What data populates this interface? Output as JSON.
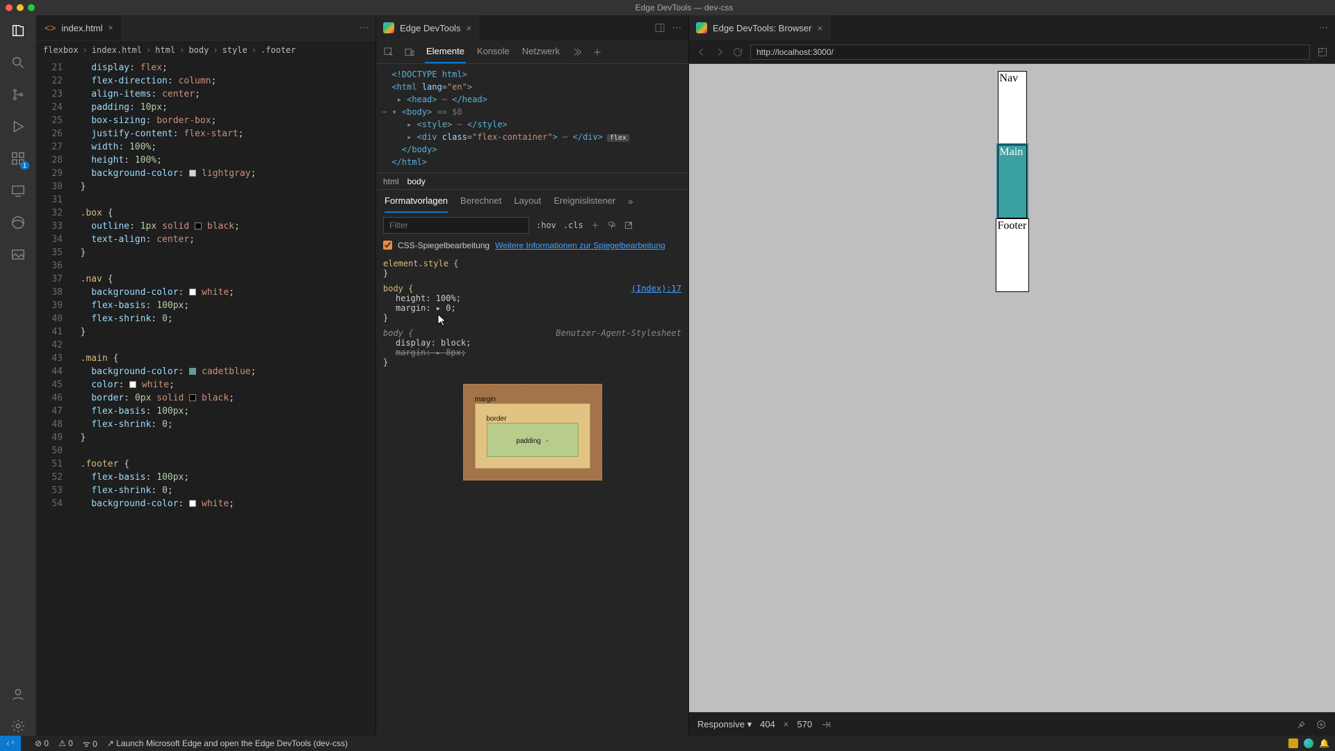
{
  "window_title": "Edge DevTools — dev-css",
  "editor_tab": {
    "filename": "index.html"
  },
  "breadcrumbs": [
    "flexbox",
    "index.html",
    "html",
    "body",
    "style",
    ".footer"
  ],
  "line_start": 21,
  "code_lines": [
    [
      [
        "prop",
        "display"
      ],
      [
        "punc",
        ": "
      ],
      [
        "val",
        "flex"
      ],
      [
        "punc",
        ";"
      ]
    ],
    [
      [
        "prop",
        "flex-direction"
      ],
      [
        "punc",
        ": "
      ],
      [
        "val",
        "column"
      ],
      [
        "punc",
        ";"
      ]
    ],
    [
      [
        "prop",
        "align-items"
      ],
      [
        "punc",
        ": "
      ],
      [
        "val",
        "center"
      ],
      [
        "punc",
        ";"
      ]
    ],
    [
      [
        "prop",
        "padding"
      ],
      [
        "punc",
        ": "
      ],
      [
        "num",
        "10px"
      ],
      [
        "punc",
        ";"
      ]
    ],
    [
      [
        "prop",
        "box-sizing"
      ],
      [
        "punc",
        ": "
      ],
      [
        "val",
        "border-box"
      ],
      [
        "punc",
        ";"
      ]
    ],
    [
      [
        "prop",
        "justify-content"
      ],
      [
        "punc",
        ": "
      ],
      [
        "val",
        "flex-start"
      ],
      [
        "punc",
        ";"
      ]
    ],
    [
      [
        "prop",
        "width"
      ],
      [
        "punc",
        ": "
      ],
      [
        "num",
        "100%"
      ],
      [
        "punc",
        ";"
      ]
    ],
    [
      [
        "prop",
        "height"
      ],
      [
        "punc",
        ": "
      ],
      [
        "num",
        "100%"
      ],
      [
        "punc",
        ";"
      ]
    ],
    [
      [
        "prop",
        "background-color"
      ],
      [
        "punc",
        ": "
      ],
      [
        "swatch",
        "#d3d3d3"
      ],
      [
        "val",
        "lightgray"
      ],
      [
        "punc",
        ";"
      ]
    ],
    [
      [
        "punc",
        "}"
      ],
      [
        "",
        ""
      ]
    ],
    [],
    [
      [
        "sel",
        ".box "
      ],
      [
        "punc",
        "{"
      ]
    ],
    [
      [
        "prop",
        "outline"
      ],
      [
        "punc",
        ": "
      ],
      [
        "num",
        "1px "
      ],
      [
        "val",
        "solid "
      ],
      [
        "swatch",
        "#000"
      ],
      [
        "val",
        "black"
      ],
      [
        "punc",
        ";"
      ]
    ],
    [
      [
        "prop",
        "text-align"
      ],
      [
        "punc",
        ": "
      ],
      [
        "val",
        "center"
      ],
      [
        "punc",
        ";"
      ]
    ],
    [
      [
        "punc",
        "}"
      ],
      [
        "",
        ""
      ]
    ],
    [],
    [
      [
        "sel",
        ".nav "
      ],
      [
        "punc",
        "{"
      ]
    ],
    [
      [
        "prop",
        "background-color"
      ],
      [
        "punc",
        ": "
      ],
      [
        "swatch",
        "#fff"
      ],
      [
        "val",
        "white"
      ],
      [
        "punc",
        ";"
      ]
    ],
    [
      [
        "prop",
        "flex-basis"
      ],
      [
        "punc",
        ": "
      ],
      [
        "num",
        "100px"
      ],
      [
        "punc",
        ";"
      ]
    ],
    [
      [
        "prop",
        "flex-shrink"
      ],
      [
        "punc",
        ": "
      ],
      [
        "num",
        "0"
      ],
      [
        "punc",
        ";"
      ]
    ],
    [
      [
        "punc",
        "}"
      ],
      [
        "",
        ""
      ]
    ],
    [],
    [
      [
        "sel",
        ".main "
      ],
      [
        "punc",
        "{"
      ]
    ],
    [
      [
        "prop",
        "background-color"
      ],
      [
        "punc",
        ": "
      ],
      [
        "swatch",
        "#5f9ea0"
      ],
      [
        "val",
        "cadetblue"
      ],
      [
        "punc",
        ";"
      ]
    ],
    [
      [
        "prop",
        "color"
      ],
      [
        "punc",
        ": "
      ],
      [
        "swatch",
        "#fff"
      ],
      [
        "val",
        "white"
      ],
      [
        "punc",
        ";"
      ]
    ],
    [
      [
        "prop",
        "border"
      ],
      [
        "punc",
        ": "
      ],
      [
        "num",
        "0px "
      ],
      [
        "val",
        "solid "
      ],
      [
        "swatch",
        "#000"
      ],
      [
        "val",
        "black"
      ],
      [
        "punc",
        ";"
      ]
    ],
    [
      [
        "prop",
        "flex-basis"
      ],
      [
        "punc",
        ": "
      ],
      [
        "num",
        "100px"
      ],
      [
        "punc",
        ";"
      ]
    ],
    [
      [
        "prop",
        "flex-shrink"
      ],
      [
        "punc",
        ": "
      ],
      [
        "num",
        "0"
      ],
      [
        "punc",
        ";"
      ]
    ],
    [
      [
        "punc",
        "}"
      ],
      [
        "",
        ""
      ]
    ],
    [],
    [
      [
        "sel",
        ".footer "
      ],
      [
        "punc",
        "{"
      ]
    ],
    [
      [
        "prop",
        "flex-basis"
      ],
      [
        "punc",
        ": "
      ],
      [
        "num",
        "100px"
      ],
      [
        "punc",
        ";"
      ]
    ],
    [
      [
        "prop",
        "flex-shrink"
      ],
      [
        "punc",
        ": "
      ],
      [
        "num",
        "0"
      ],
      [
        "punc",
        ";"
      ]
    ],
    [
      [
        "prop",
        "background-color"
      ],
      [
        "punc",
        ": "
      ],
      [
        "swatch",
        "#fff"
      ],
      [
        "val",
        "white"
      ],
      [
        "punc",
        ";"
      ]
    ]
  ],
  "devtools_tab_title": "Edge DevTools",
  "devtools_tabs": [
    "Elemente",
    "Konsole",
    "Netzwerk"
  ],
  "dom_path": [
    "html",
    "body"
  ],
  "styles_tabs": [
    "Formatvorlagen",
    "Berechnet",
    "Layout",
    "Ereignislistener"
  ],
  "filter_placeholder": "Filter",
  "hov_label": ":hov",
  "cls_label": ".cls",
  "mirror_label": "CSS-Spiegelbearbeitung",
  "mirror_link": "Weitere Informationen zur Spiegelbearbeitung",
  "rules": {
    "element_style": "element.style {",
    "body_src": "(Index):17",
    "body_sel": "body {",
    "body_height": "height: 100%;",
    "body_margin": "margin: ▸ 0;",
    "ua_label": "Benutzer-Agent-Stylesheet",
    "ua_sel": "body {",
    "ua_display": "display: block;",
    "ua_margin": "margin: ▸ 8px;"
  },
  "box_model": {
    "margin": "margin",
    "border": "border",
    "padding": "padding",
    "dash": "-"
  },
  "browser_tab_title": "Edge DevTools: Browser",
  "url": "http://localhost:3000/",
  "preview": {
    "nav": "Nav",
    "main": "Main",
    "footer": "Footer"
  },
  "device": {
    "mode": "Responsive",
    "width": "404",
    "height": "570"
  },
  "status": {
    "errors": "0",
    "warnings": "0",
    "port": "0",
    "msg": "Launch Microsoft Edge and open the Edge DevTools (dev-css)"
  },
  "icons": {
    "chevron_right": "›",
    "activity_badge": "1"
  }
}
